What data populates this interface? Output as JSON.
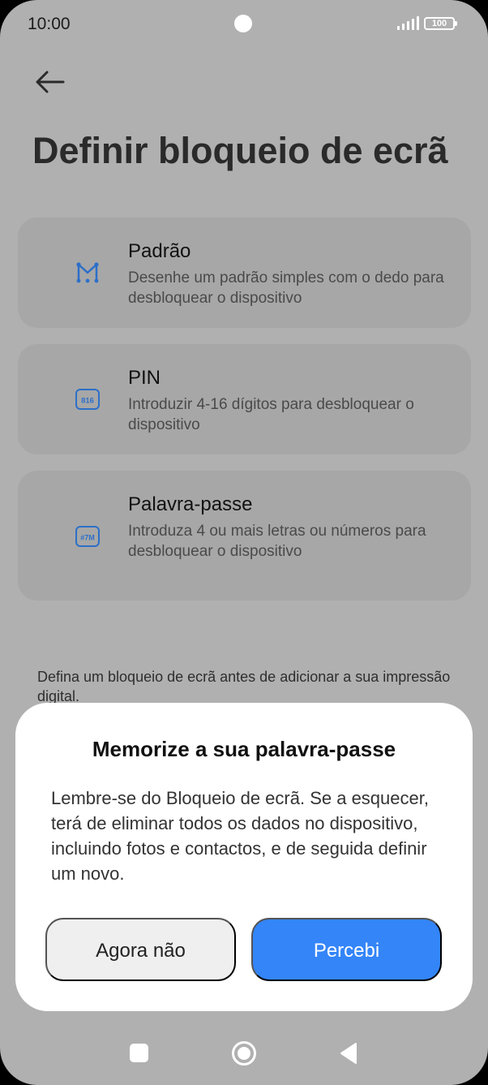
{
  "status_bar": {
    "time": "10:00",
    "battery": "100",
    "icons": [
      "camera-cutout",
      "signal-icon",
      "battery-icon"
    ]
  },
  "header": {
    "back_icon": "arrow-left-icon",
    "title": "Definir bloqueio de ecrã"
  },
  "options": [
    {
      "title": "Padrão",
      "description": "Desenhe um padrão simples com o dedo para desbloquear o dispositivo",
      "icon": "pattern-icon"
    },
    {
      "title": "PIN",
      "description": "Introduzir 4-16 dígitos para desbloquear o dispositivo",
      "icon": "pin-icon",
      "icon_text": "816"
    },
    {
      "title": "Palavra-passe",
      "description": "Introduza 4 ou mais letras ou números para desbloquear o dispositivo",
      "icon": "password-icon",
      "icon_text": "#7M"
    }
  ],
  "footer_note": "Defina um bloqueio de ecrã antes de adicionar a sua impressão digital.",
  "dialog": {
    "title": "Memorize a sua palavra-passe",
    "body": "Lembre-se do Bloqueio de ecrã. Se a esquecer, terá de eliminar todos os dados no dispositivo, incluindo fotos e contactos, e de seguida definir um novo.",
    "secondary_label": "Agora não",
    "primary_label": "Percebi"
  },
  "nav_bar": {
    "icons": [
      "recent-apps-icon",
      "home-icon",
      "back-triangle-icon"
    ]
  },
  "colors": {
    "accent": "#3385f8",
    "icon_blue": "#2c6fc9",
    "scrim_background": "#b0b0b0",
    "card_background": "#a7a7a7"
  }
}
